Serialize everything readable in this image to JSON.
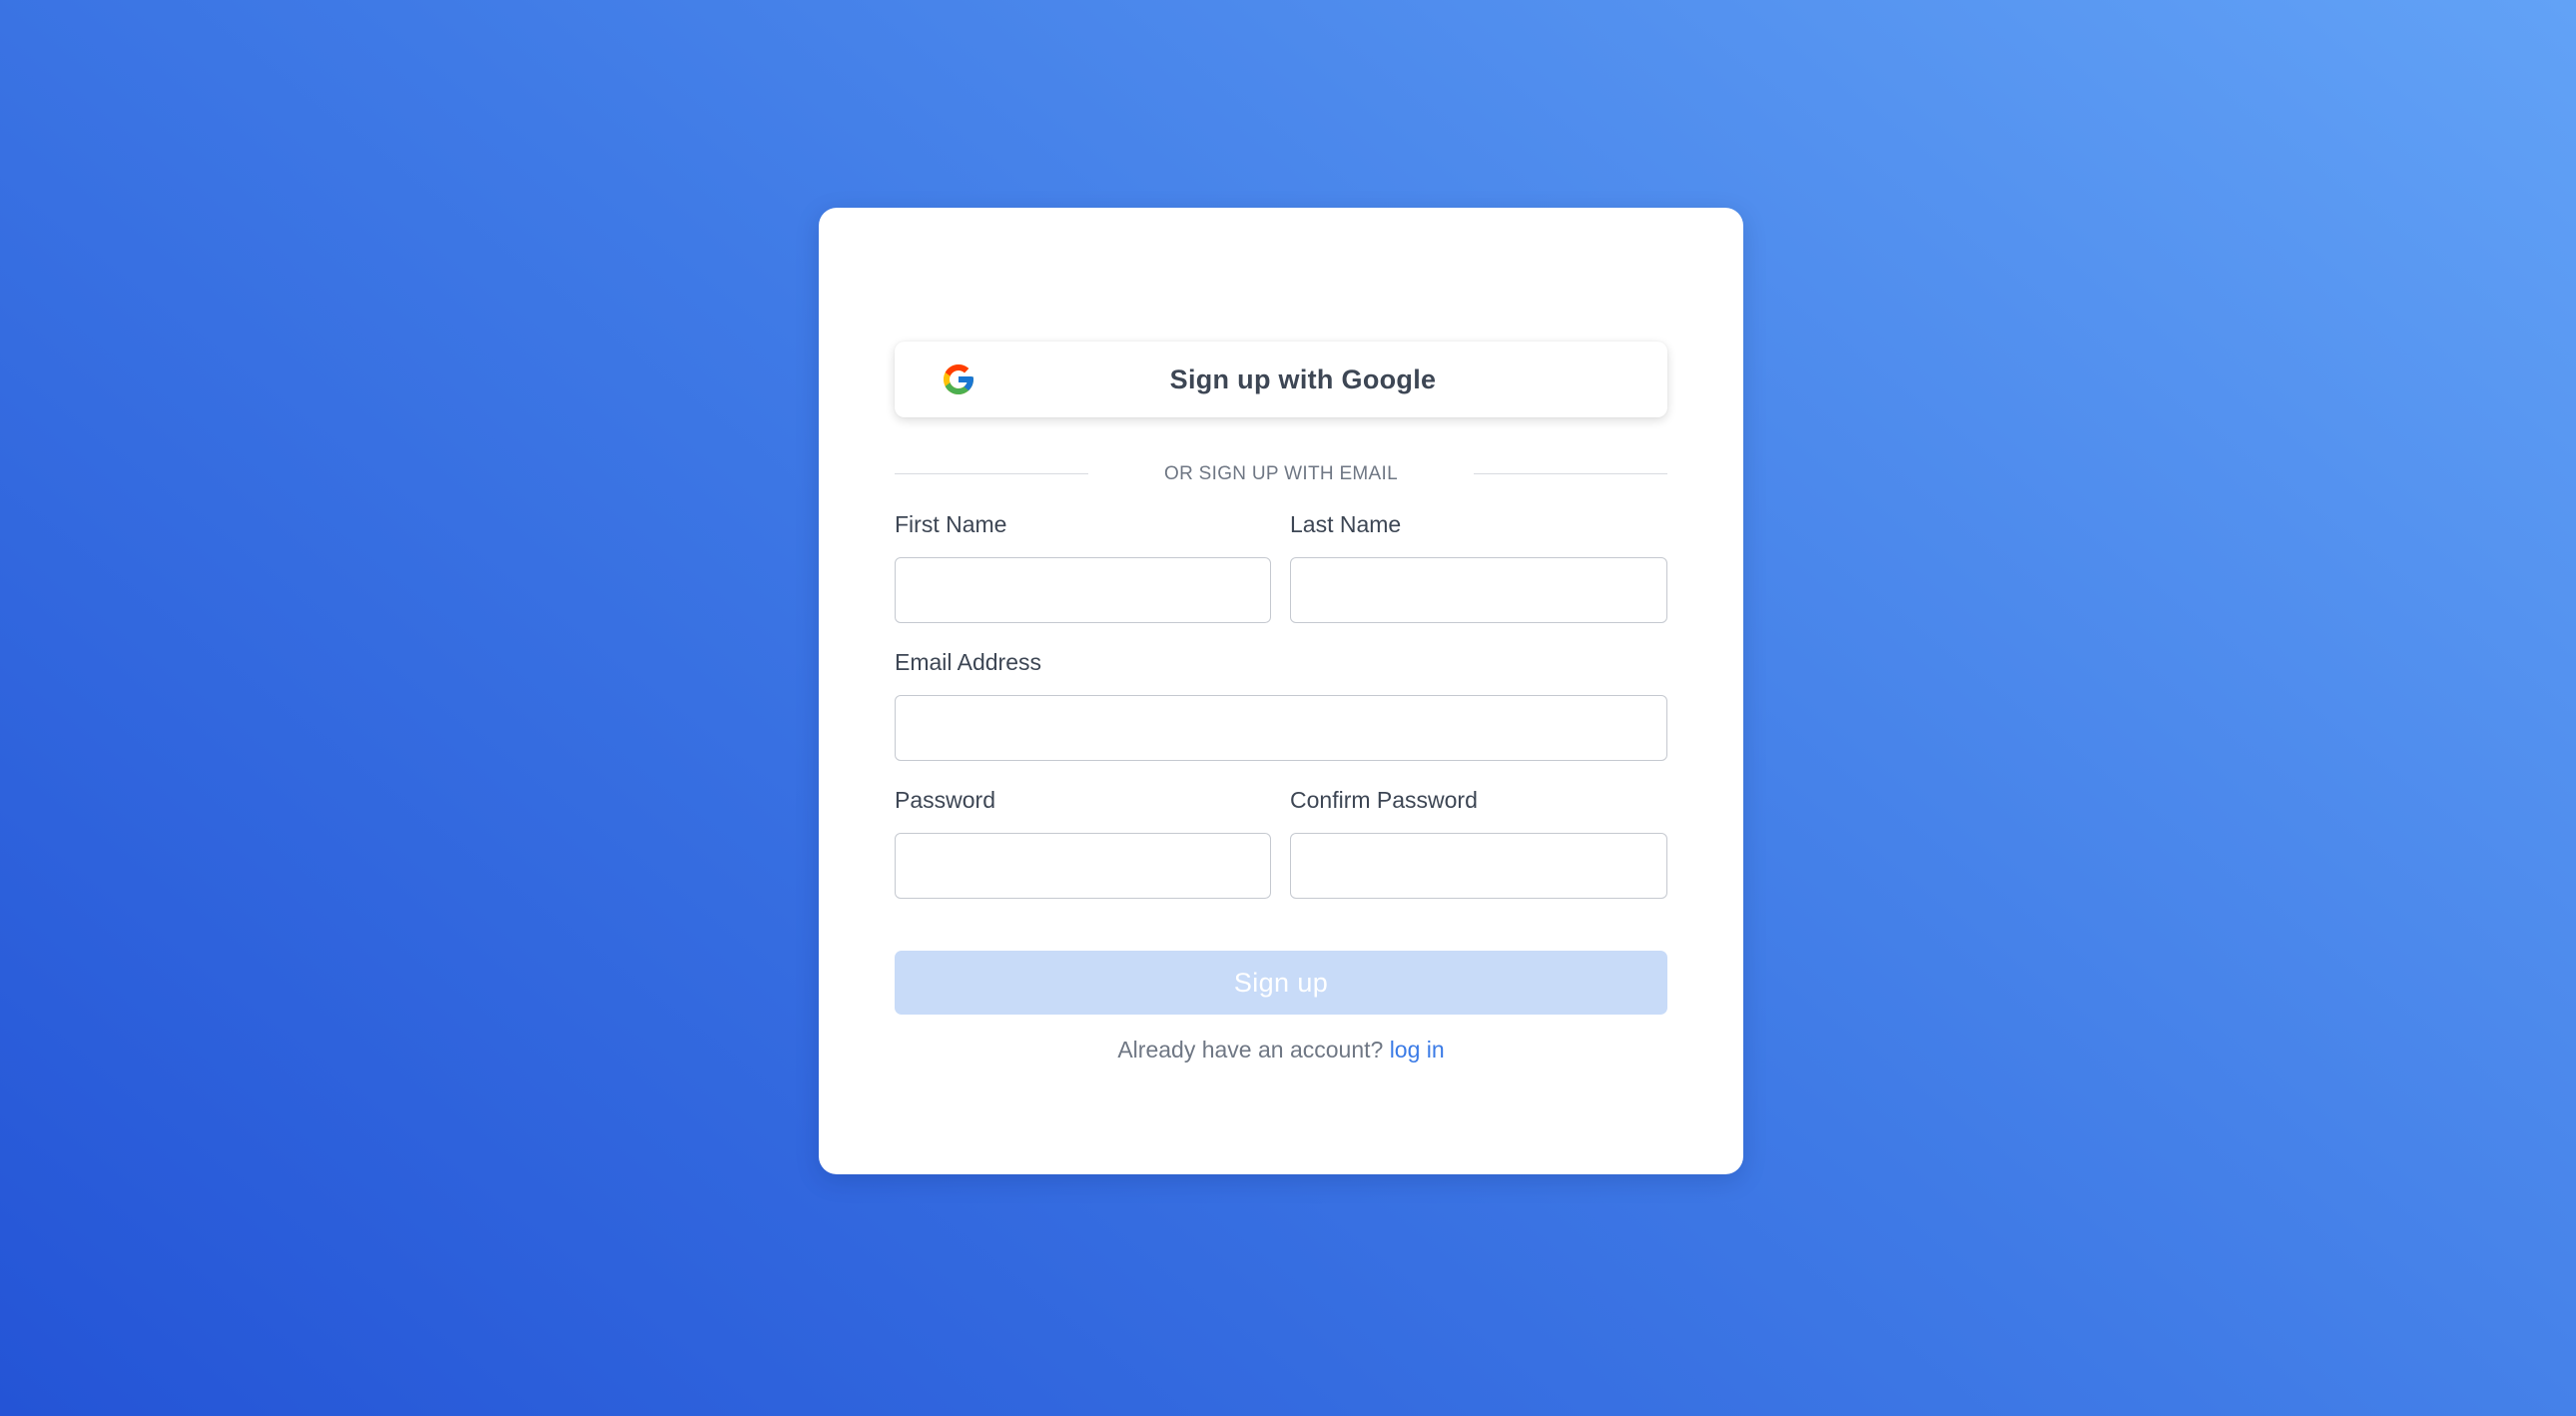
{
  "google_button": {
    "label": "Sign up with Google",
    "icon": "google-icon"
  },
  "divider": {
    "text": "OR SIGN UP WITH EMAIL"
  },
  "form": {
    "first_name_label": "First Name",
    "first_name_value": "",
    "last_name_label": "Last Name",
    "last_name_value": "",
    "email_label": "Email Address",
    "email_value": "",
    "password_label": "Password",
    "password_value": "",
    "confirm_password_label": "Confirm Password",
    "confirm_password_value": ""
  },
  "submit": {
    "label": "Sign up",
    "enabled": false
  },
  "footer": {
    "prompt": "Already have an account?",
    "link_label": "log in"
  },
  "colors": {
    "background_start": "#2454d6",
    "background_end": "#62a2f6",
    "card": "#ffffff",
    "text": "#3d4654",
    "muted_text": "#6f7784",
    "link": "#3b7be6",
    "submit_disabled": "#c8dbf8"
  }
}
